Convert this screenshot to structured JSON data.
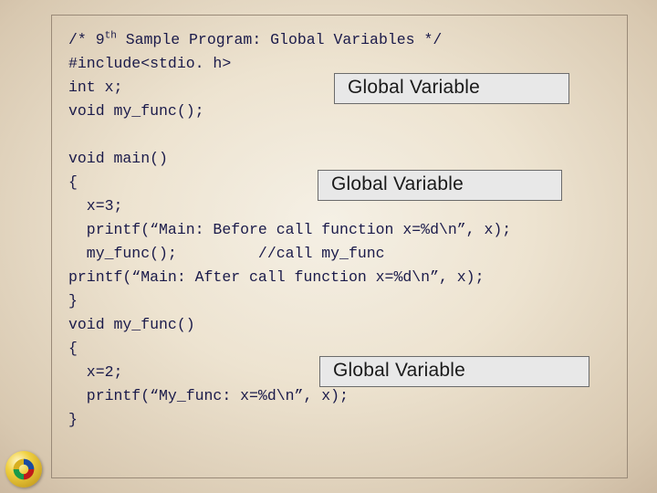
{
  "code": {
    "l1a": "/* 9",
    "l1b": "th",
    "l1c": " Sample Program: Global Variables */",
    "l2": "#include<stdio. h>",
    "l3": "int x;",
    "l4": "void my_func();",
    "l5": "",
    "l6": "void main()",
    "l7": "{",
    "l8": "  x=3;",
    "l9": "  printf(“Main: Before call function x=%d\\n”, x);",
    "l10": "  my_func();         //call my_func",
    "l11": "printf(“Main: After call function x=%d\\n”, x);",
    "l12": "}",
    "l13": "void my_func()",
    "l14": "{",
    "l15": "  x=2;",
    "l16": "  printf(“My_func: x=%d\\n”, x);",
    "l17": "}"
  },
  "callouts": {
    "c1": "Global Variable",
    "c2": "Global Variable",
    "c3": "Global Variable"
  }
}
